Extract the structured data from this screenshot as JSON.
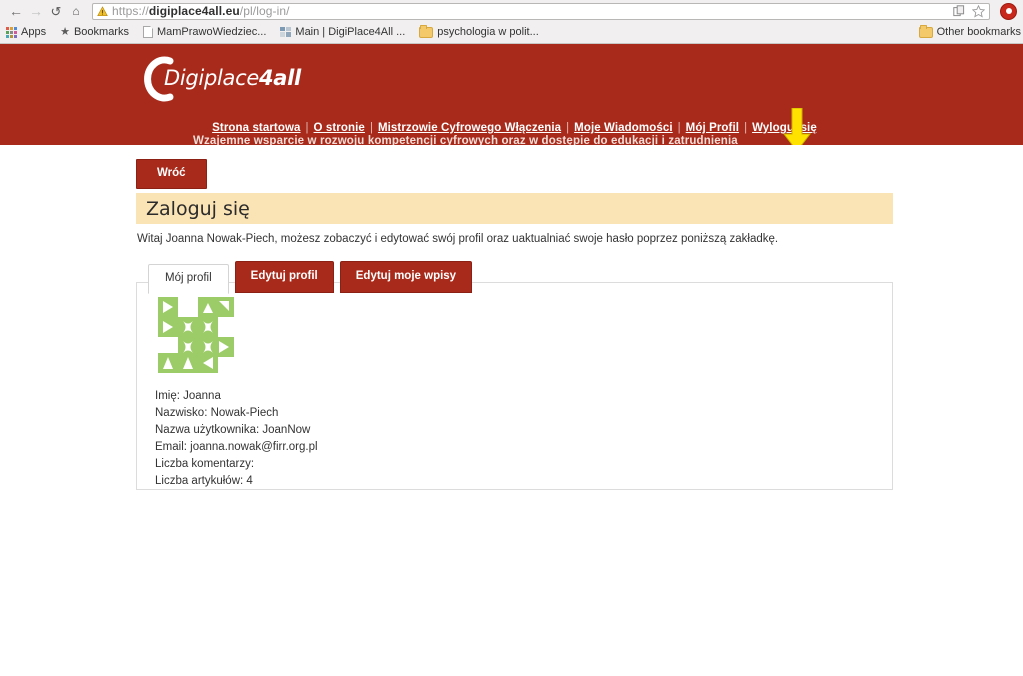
{
  "browser": {
    "back_icon": "back-arrow-icon",
    "forward_icon": "forward-arrow-icon",
    "reload_icon": "reload-icon",
    "home_icon": "home-icon",
    "url_prefix": "https://",
    "url_domain": "digiplace4all.eu",
    "url_path": "/pl/log-in/",
    "site_icon": "warning-triangle-icon",
    "copy_icon": "copy-icon",
    "star_icon": "star-bookmark-icon",
    "extension_icon": "extension-icon",
    "bookmarks": [
      {
        "label": "Apps",
        "icon": "apps-grid-icon"
      },
      {
        "label": "Bookmarks",
        "icon": "star-icon"
      },
      {
        "label": "MamPrawoWiedziec...",
        "icon": "page-icon"
      },
      {
        "label": "Main | DigiPlace4All ...",
        "icon": "tiles-icon"
      },
      {
        "label": "psychologia w polit...",
        "icon": "folder-icon"
      }
    ],
    "other_bookmarks": {
      "label": "Other bookmarks",
      "icon": "folder-icon"
    }
  },
  "header": {
    "logo_text_light": "Digiplace",
    "logo_text_bold": "4all",
    "tagline": "Wzajemne wsparcie w rozwoju kompetencji cyfrowych oraz w dostępie do edukacji i zatrudnienia",
    "nav": [
      {
        "label": "Strona startowa"
      },
      {
        "label": "O stronie"
      },
      {
        "label": "Mistrzowie Cyfrowego Włączenia"
      },
      {
        "label": "Moje Wiadomości"
      },
      {
        "label": "Mój Profil"
      },
      {
        "label": "Wyloguj się"
      }
    ],
    "separator": "|"
  },
  "annotations": {
    "arrow": "down-arrow-annotation",
    "ellipse": "highlight-ellipse-annotation",
    "color": "#ffe200",
    "target": "Mój Profil"
  },
  "main": {
    "back_button": "Wróć",
    "page_title": "Zaloguj się",
    "welcome": "Witaj Joanna Nowak-Piech, możesz zobaczyć i edytować swój profil oraz uaktualniać swoje hasło poprzez poniższą zakładkę.",
    "tabs": [
      {
        "label": "Mój profil",
        "active": true
      },
      {
        "label": "Edytuj profil",
        "active": false
      },
      {
        "label": "Edytuj moje wpisy",
        "active": false
      }
    ],
    "avatar": "identicon-avatar",
    "avatar_color": "#9ccc67",
    "profile": [
      {
        "label": "Imię:",
        "value": "Joanna"
      },
      {
        "label": "Nazwisko:",
        "value": "Nowak-Piech"
      },
      {
        "label": "Nazwa użytkownika:",
        "value": "JoanNow"
      },
      {
        "label": "Email:",
        "value": "joanna.nowak@firr.org.pl"
      },
      {
        "label": "Liczba komentarzy:",
        "value": ""
      },
      {
        "label": "Liczba artykułów:",
        "value": "4"
      }
    ]
  },
  "colors": {
    "brand_red": "#a82a1b",
    "title_band": "#fae3b4",
    "annotation_yellow": "#ffe200"
  }
}
